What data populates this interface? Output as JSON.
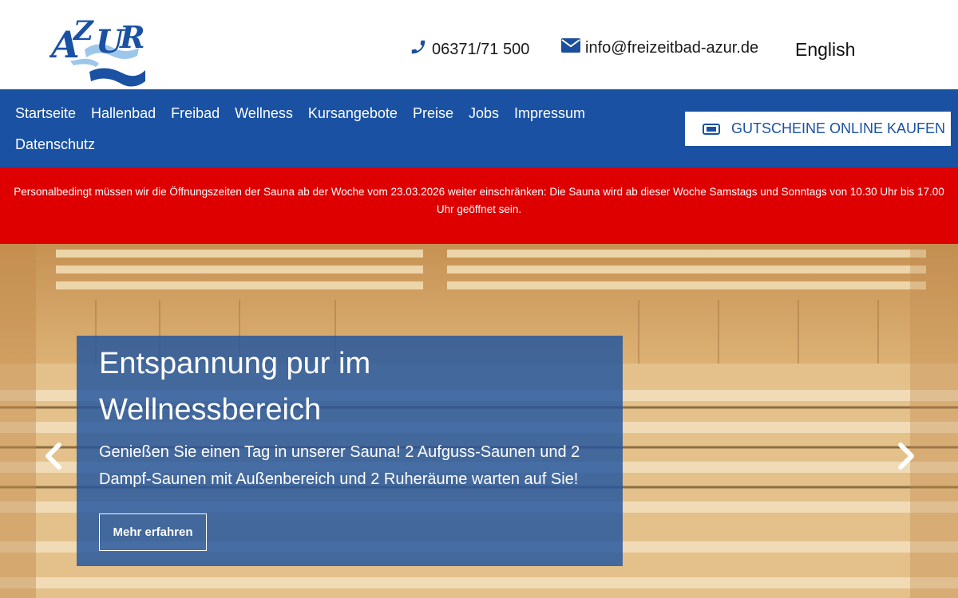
{
  "header": {
    "logo_text": "AZUR",
    "phone": "06371/71 500",
    "email": "info@freizeitbad-azur.de",
    "language": "English"
  },
  "nav": {
    "items": [
      "Startseite",
      "Hallenbad",
      "Freibad",
      "Wellness",
      "Kursangebote",
      "Preise",
      "Jobs",
      "Impressum",
      "Datenschutz"
    ],
    "voucher_label": "GUTSCHEINE ONLINE KAUFEN"
  },
  "alert": {
    "text": "Personalbedingt müssen wir die Öffnungszeiten der Sauna ab der Woche vom 23.03.2026 weiter einschränken: Die Sauna wird ab dieser Woche Samstags und Sonntags von 10.30 Uhr bis 17.00 Uhr geöffnet sein."
  },
  "hero": {
    "title": "Entspannung pur im Wellnessbereich",
    "text": "Genießen Sie einen Tag in unserer Sauna! 2 Aufguss-Saunen und 2 Dampf-Saunen mit Außenbereich und 2 Ruheräume warten auf Sie!",
    "button_label": "Mehr erfahren"
  },
  "colors": {
    "nav_blue": "#1a51a3",
    "alert_red": "#de0000",
    "caption_blue": "#2054a0"
  },
  "icons": [
    "phone-icon",
    "envelope-icon",
    "ticket-icon",
    "chevron-left-icon",
    "chevron-right-icon"
  ]
}
